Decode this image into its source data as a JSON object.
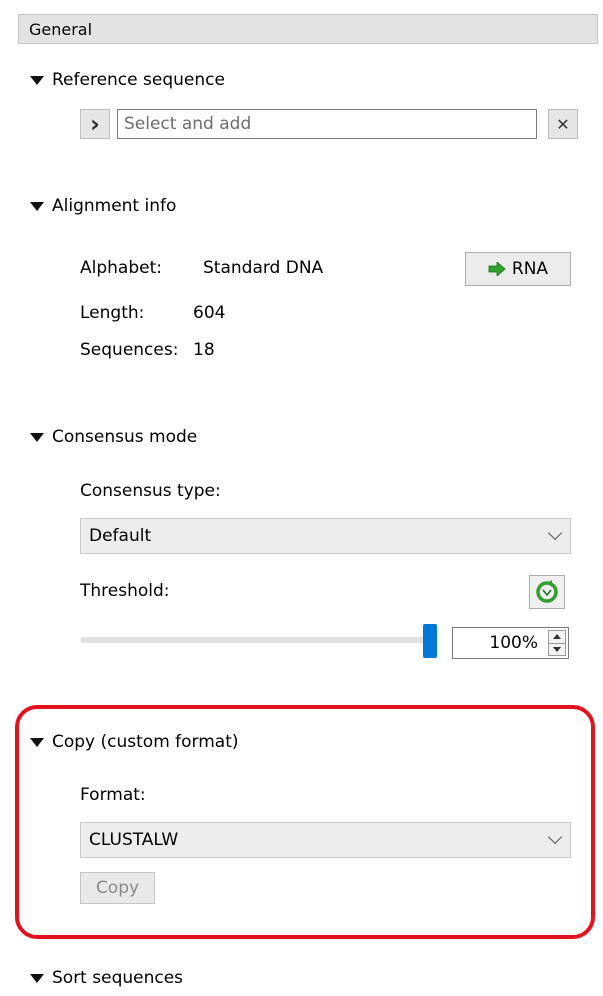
{
  "header": {
    "title": "General"
  },
  "reference_sequence": {
    "title": "Reference sequence",
    "input_placeholder": "Select and add",
    "expand_symbol": "›",
    "clear_symbol": "✕"
  },
  "alignment_info": {
    "title": "Alignment info",
    "alphabet_label": "Alphabet:",
    "alphabet_value": "Standard DNA",
    "rna_button_label": "RNA",
    "length_label": "Length:",
    "length_value": "604",
    "sequences_label": "Sequences:",
    "sequences_value": "18"
  },
  "consensus_mode": {
    "title": "Consensus mode",
    "type_label": "Consensus type:",
    "type_value": "Default",
    "threshold_label": "Threshold:",
    "threshold_value": "100%",
    "threshold_fraction": 1.0
  },
  "copy_custom_format": {
    "title": "Copy (custom format)",
    "format_label": "Format:",
    "format_value": "CLUSTALW",
    "copy_button_label": "Copy"
  },
  "sort_sequences": {
    "title": "Sort sequences"
  },
  "colors": {
    "highlight": "#e0131f",
    "slider_handle": "#0078d7",
    "arrow_green": "#2fa12f"
  }
}
